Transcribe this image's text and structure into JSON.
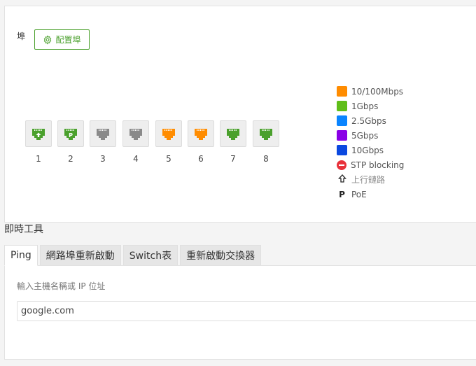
{
  "ports_section": {
    "label": "埠",
    "config_button_label": "配置埠",
    "config_icon": "gear-icon",
    "ports": [
      {
        "number": "1",
        "color": "#4aa02c",
        "marker": "uplink"
      },
      {
        "number": "2",
        "color": "#4aa02c",
        "marker": "poe"
      },
      {
        "number": "3",
        "color": "#8a8a8a",
        "marker": ""
      },
      {
        "number": "4",
        "color": "#8a8a8a",
        "marker": ""
      },
      {
        "number": "5",
        "color": "#ff8c00",
        "marker": ""
      },
      {
        "number": "6",
        "color": "#ff8c00",
        "marker": ""
      },
      {
        "number": "7",
        "color": "#4aa02c",
        "marker": ""
      },
      {
        "number": "8",
        "color": "#4aa02c",
        "marker": ""
      }
    ],
    "legend": [
      {
        "label": "10/100Mbps",
        "color": "#ff8c00"
      },
      {
        "label": "1Gbps",
        "color": "#5fbe19"
      },
      {
        "label": "2.5Gbps",
        "color": "#0a84ff"
      },
      {
        "label": "5Gbps",
        "color": "#8a00e6"
      },
      {
        "label": "10Gbps",
        "color": "#0a48e0"
      },
      {
        "label": "STP blocking",
        "icon": "stp-blocking-icon",
        "color": "#e8313a"
      },
      {
        "label": "上行鏈路",
        "icon": "uplink-arrow-icon"
      },
      {
        "label": "PoE",
        "icon": "poe-icon",
        "glyph": "P"
      }
    ]
  },
  "tools": {
    "title": "即時工具",
    "tabs": [
      {
        "label": "Ping",
        "active": true
      },
      {
        "label": "網路埠重新啟動",
        "active": false
      },
      {
        "label": "Switch表",
        "active": false
      },
      {
        "label": "重新啟動交換器",
        "active": false
      }
    ],
    "host_label": "輸入主機名稱或 IP 位址",
    "host_value": "google.com"
  }
}
